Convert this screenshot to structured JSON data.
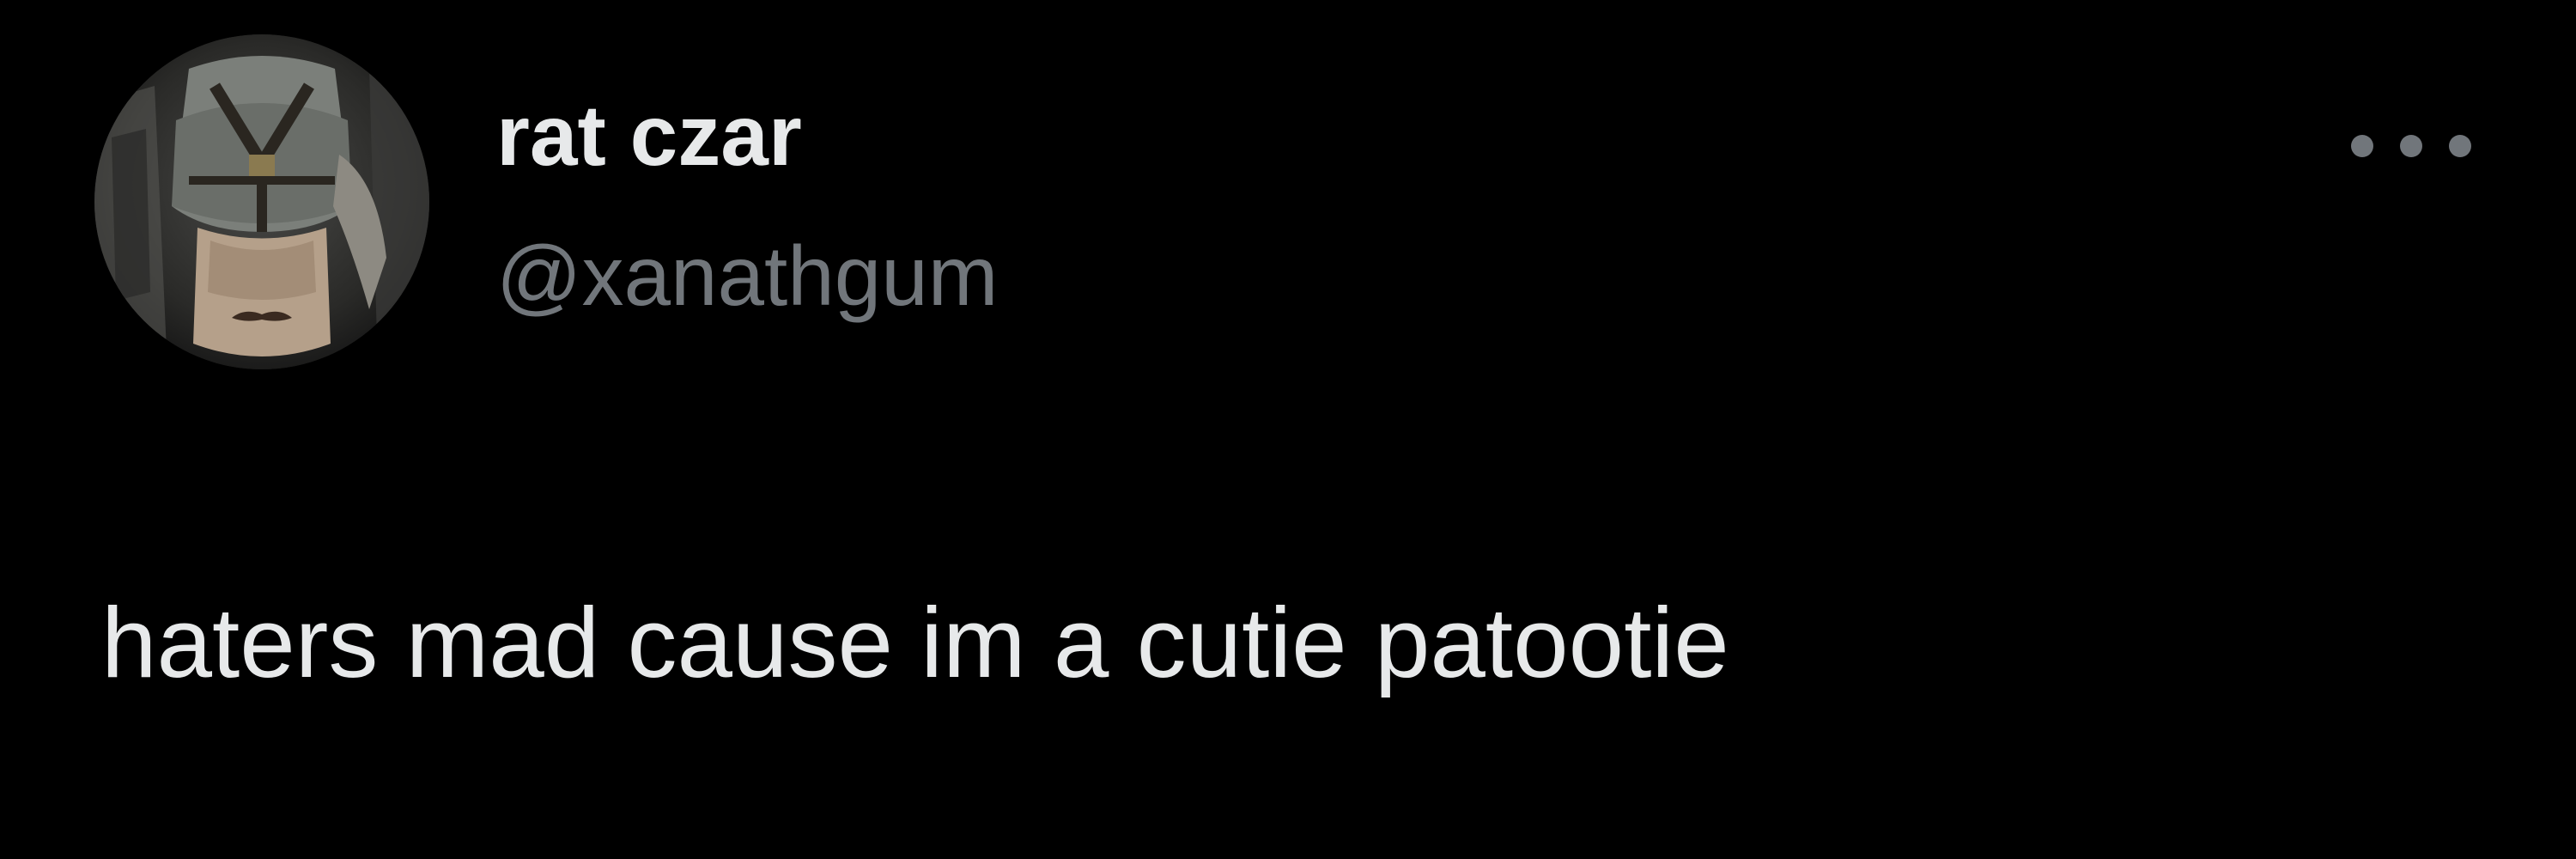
{
  "tweet": {
    "author": {
      "display_name": "rat czar",
      "handle": "@xanathgum",
      "avatar_icon": "user-avatar-photo"
    },
    "more_icon": "ellipsis-icon",
    "text": "haters mad cause im a cutie patootie"
  },
  "colors": {
    "background": "#000000",
    "primary_text": "#e7e9ea",
    "secondary_text": "#71767b"
  }
}
